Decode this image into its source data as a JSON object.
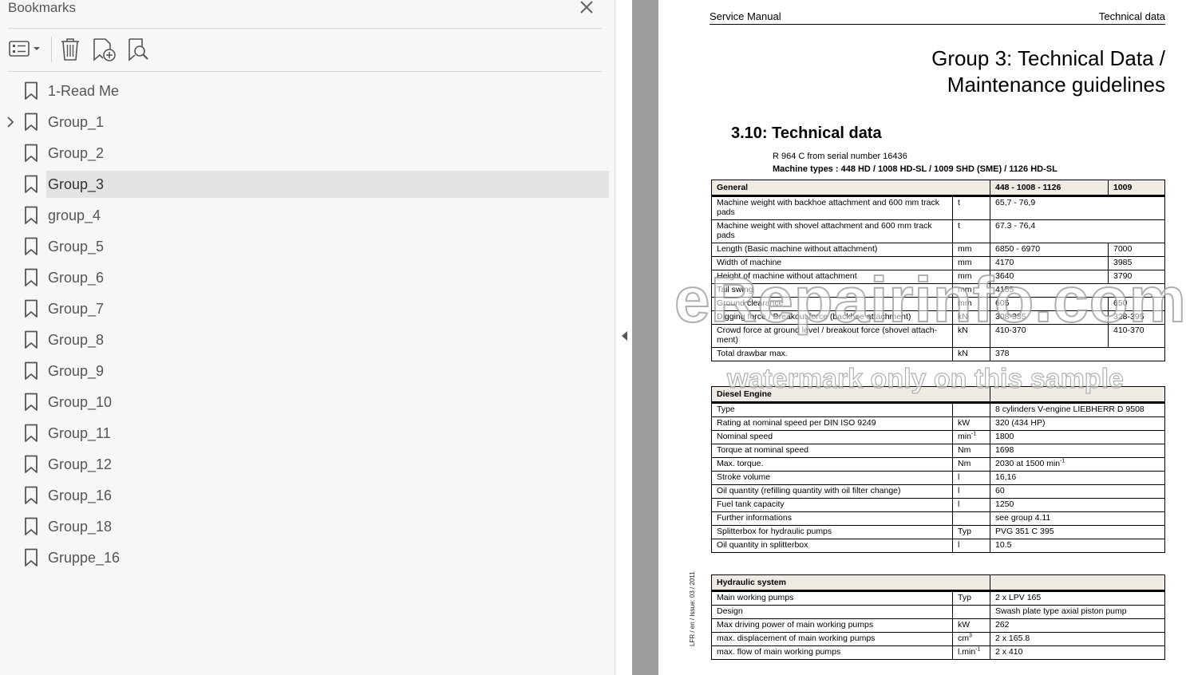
{
  "panel": {
    "title": "Bookmarks",
    "items": [
      {
        "label": "1-Read Me",
        "expandable": false,
        "selected": false
      },
      {
        "label": "Group_1",
        "expandable": true,
        "selected": false
      },
      {
        "label": "Group_2",
        "expandable": false,
        "selected": false
      },
      {
        "label": "Group_3",
        "expandable": false,
        "selected": true
      },
      {
        "label": "group_4",
        "expandable": false,
        "selected": false
      },
      {
        "label": "Group_5",
        "expandable": false,
        "selected": false
      },
      {
        "label": "Group_6",
        "expandable": false,
        "selected": false
      },
      {
        "label": "Group_7",
        "expandable": false,
        "selected": false
      },
      {
        "label": "Group_8",
        "expandable": false,
        "selected": false
      },
      {
        "label": "Group_9",
        "expandable": false,
        "selected": false
      },
      {
        "label": "Group_10",
        "expandable": false,
        "selected": false
      },
      {
        "label": "Group_11",
        "expandable": false,
        "selected": false
      },
      {
        "label": "Group_12",
        "expandable": false,
        "selected": false
      },
      {
        "label": "Group_16",
        "expandable": false,
        "selected": false
      },
      {
        "label": "Group_18",
        "expandable": false,
        "selected": false
      },
      {
        "label": "Gruppe_16",
        "expandable": false,
        "selected": false
      }
    ]
  },
  "doc": {
    "header_left": "Service Manual",
    "header_right": "Technical data",
    "title_line1": "Group 3: Technical Data /",
    "title_line2": "Maintenance guidelines",
    "section": "3.10: Technical data",
    "serial": "R 964 C from serial number 16436",
    "types": "Machine types : 448 HD / 1008 HD-SL / 1009 SHD (SME) / 1126 HD-SL",
    "side_note": "LFR / en / Issue: 03 / 2011",
    "general": {
      "header": {
        "name": "General",
        "col1": "448 - 1008 - 1126",
        "col2": "1009"
      },
      "rows": [
        {
          "name": "Machine weight with backhoe attachment and 600 mm track pads",
          "unit": "t",
          "v1": "65,7 - 76,9",
          "v2": ""
        },
        {
          "name": "Machine weight with shovel attachment and 600 mm track pads",
          "unit": "t",
          "v1": "67.3 - 76,4",
          "v2": ""
        },
        {
          "name": "Length (Basic machine without attachment)",
          "unit": "mm",
          "v1": "6850 - 6970",
          "v2": "7000"
        },
        {
          "name": "Width of machine",
          "unit": "mm",
          "v1": "4170",
          "v2": "3985"
        },
        {
          "name": "Height of machine without attachment",
          "unit": "mm",
          "v1": "3640",
          "v2": "3790"
        },
        {
          "name": "Tail swing",
          "unit": "mm",
          "v1": "4155",
          "v2": ""
        },
        {
          "name": "Ground clearance",
          "unit": "mm",
          "v1": "605",
          "v2": "650"
        },
        {
          "name": "Digging force / Breakout force (backhoe attachment)",
          "unit": "kN",
          "v1": "308-335",
          "v2": "328-395"
        },
        {
          "name": "Crowd force at ground level / breakout force (shovel attach-ment)",
          "unit": "kN",
          "v1": "410-370",
          "v2": "410-370"
        },
        {
          "name": "Total drawbar  max.",
          "unit": "kN",
          "v1": "378",
          "v2": ""
        }
      ]
    },
    "engine": {
      "header": "Diesel Engine",
      "rows": [
        {
          "name": "Type",
          "unit": "",
          "unit_sup": "",
          "value": "8 cylinders V-engine LIEBHERR D 9508",
          "value_sup": ""
        },
        {
          "name": "Rating at nominal speed per DIN ISO 9249",
          "unit": "kW",
          "unit_sup": "",
          "value": "320 (434 HP)",
          "value_sup": ""
        },
        {
          "name": "Nominal speed",
          "unit": "min",
          "unit_sup": "-1",
          "value": "1800",
          "value_sup": ""
        },
        {
          "name": "Torque at nominal speed",
          "unit": "Nm",
          "unit_sup": "",
          "value": "1698",
          "value_sup": ""
        },
        {
          "name": "Max. torque.",
          "unit": "Nm",
          "unit_sup": "",
          "value": "2030 at 1500 min",
          "value_sup": "-1"
        },
        {
          "name": "Stroke volume",
          "unit": "l",
          "unit_sup": "",
          "value": "16,16",
          "value_sup": ""
        },
        {
          "name": "Oil quantity (refilling quantity with oil filter change)",
          "unit": "l",
          "unit_sup": "",
          "value": "60",
          "value_sup": ""
        },
        {
          "name": "Fuel tank capacity",
          "unit": "l",
          "unit_sup": "",
          "value": "1250",
          "value_sup": ""
        },
        {
          "name": "Further informations",
          "unit": "",
          "unit_sup": "",
          "value": "see group  4.11",
          "value_sup": ""
        },
        {
          "name": "Splitterbox for hydraulic pumps",
          "unit": "Typ",
          "unit_sup": "",
          "value": "PVG 351 C 395",
          "value_sup": ""
        },
        {
          "name": "Oil quantity in splitterbox",
          "unit": "l",
          "unit_sup": "",
          "value": "10.5",
          "value_sup": ""
        }
      ]
    },
    "hydraulic": {
      "header": "Hydraulic system",
      "rows": [
        {
          "name": "Main working pumps",
          "unit": "Typ",
          "unit_sup": "",
          "value": "2 x LPV 165",
          "value_sup": ""
        },
        {
          "name": "Design",
          "unit": "",
          "unit_sup": "",
          "value": "Swash plate type axial piston pump",
          "value_sup": ""
        },
        {
          "name": "Max driving power of main working pumps",
          "unit": "kW",
          "unit_sup": "",
          "value": "262",
          "value_sup": ""
        },
        {
          "name": "max. displacement of main working pumps",
          "unit": "cm",
          "unit_sup": "3",
          "value": "2 x 165.8",
          "value_sup": ""
        },
        {
          "name": "max. flow of main working pumps",
          "unit": "l.min",
          "unit_sup": "-1",
          "value": "2 x 410",
          "value_sup": ""
        }
      ]
    },
    "watermark_line1": "eRepairinfo.com",
    "watermark_line2": "watermark only on this sample"
  }
}
